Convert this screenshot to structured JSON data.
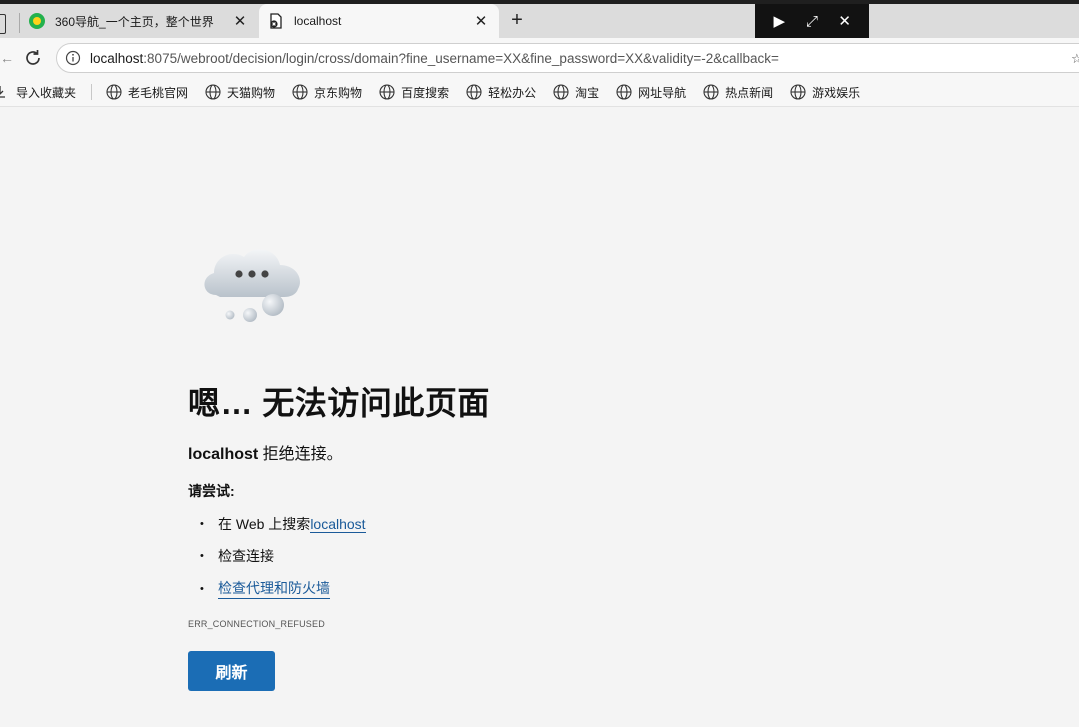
{
  "tabs": [
    {
      "title": "360导航_一个主页，整个世界",
      "close": "✕",
      "favicon": "360-logo-icon"
    },
    {
      "title": "localhost",
      "close": "✕",
      "favicon": "page-error-icon",
      "active": true
    }
  ],
  "new_tab": "+",
  "overlay_controls": {
    "send": "▶",
    "restore": "⤢",
    "close": "✕"
  },
  "address": {
    "host": "localhost",
    "path": ":8075/webroot/decision/login/cross/domain?fine_username=XX&fine_password=XX&validity=-2&callback="
  },
  "bookmarks": {
    "import": "导入收藏夹",
    "items": [
      "老毛桃官网",
      "天猫购物",
      "京东购物",
      "百度搜索",
      "轻松办公",
      "淘宝",
      "网址导航",
      "热点新闻",
      "游戏娱乐"
    ]
  },
  "error": {
    "heading": "嗯… 无法访问此页面",
    "subtitle_host": "localhost",
    "subtitle_rest": " 拒绝连接。",
    "try_label": "请尝试:",
    "s1_prefix": "在 Web 上搜索 ",
    "s1_link": "localhost",
    "s2": "检查连接",
    "s3_link": "检查代理和防火墙",
    "code": "ERR_CONNECTION_REFUSED",
    "refresh": "刷新"
  },
  "colors": {
    "accent": "#1b6db5",
    "link": "#1a5a99",
    "page_bg": "#f4f4f4"
  }
}
